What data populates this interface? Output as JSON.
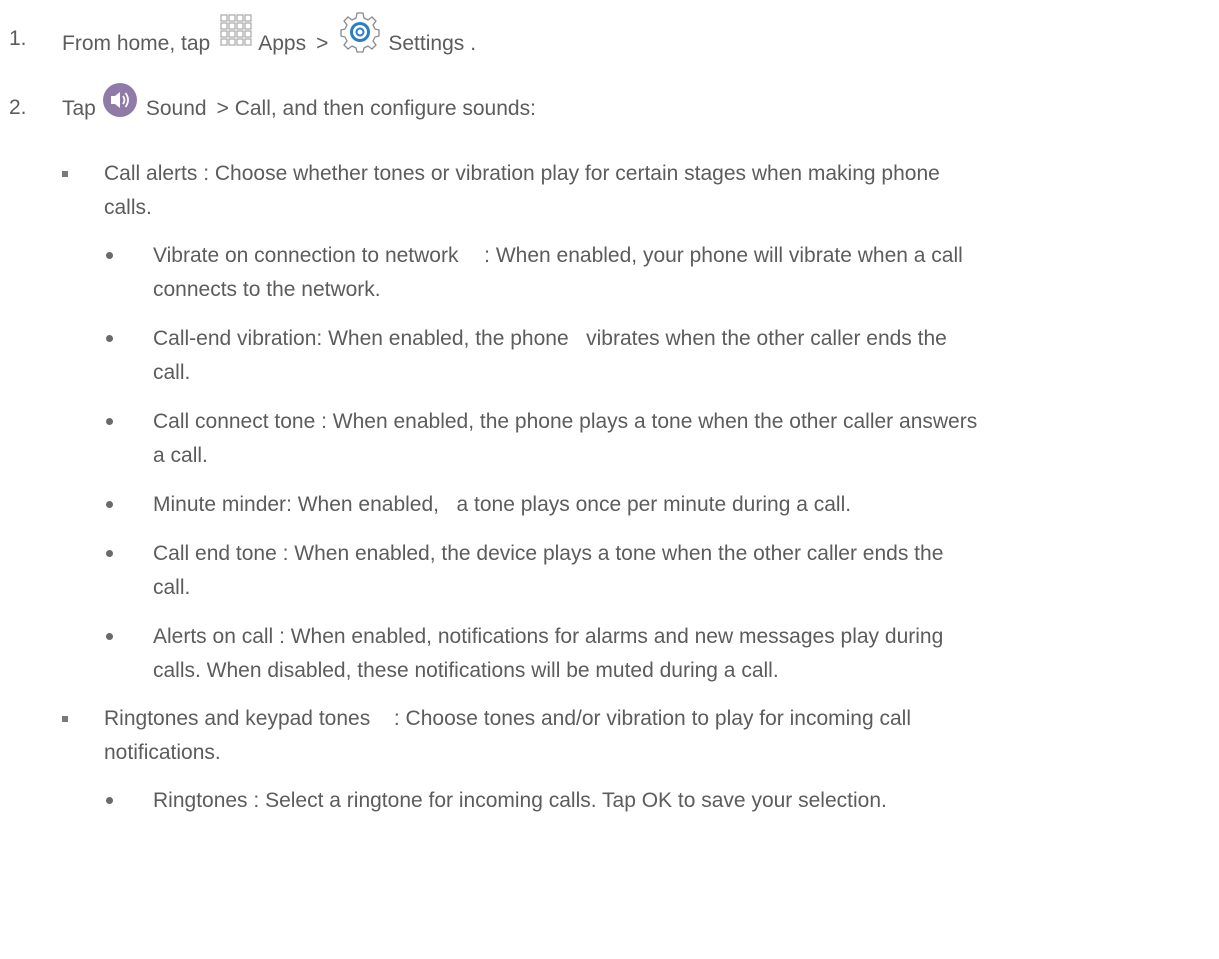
{
  "steps": [
    {
      "number": "1.",
      "prefix": "From home, tap",
      "icon1": "apps-grid-icon",
      "label1": "Apps",
      "sep": ">",
      "icon2": "settings-gear-icon",
      "label2": "Settings",
      "suffix": "."
    },
    {
      "number": "2.",
      "prefix": "Tap",
      "icon1": "sound-speaker-icon",
      "label1": "Sound",
      "sep": "> Call",
      "suffix": ", and then configure sounds:"
    }
  ],
  "items": [
    {
      "term": "Call alerts",
      "desc_line1": ": Choose whether tones or vibration play for certain stages when making phone",
      "desc_line2": "calls."
    },
    {
      "term": "Vibrate on connection to network",
      "desc_line1": ": When enabled, your phone will vibrate when a call",
      "desc_line2": "connects to the network."
    },
    {
      "term": "Call-end vibration",
      "desc_line1": ": When enabled, the phone   vibrates when the other caller ends the",
      "desc_line2": "call."
    },
    {
      "term": "Call connect tone",
      "desc_line1": ": When enabled, the phone plays a tone when the other caller answers",
      "desc_line2": "a call."
    },
    {
      "term": "Minute minder",
      "desc_line1": ": When enabled,   a tone plays once per minute during a call.",
      "desc_line2": ""
    },
    {
      "term": "Call end tone",
      "desc_line1": ": When enabled, the device plays a tone when the other caller ends the",
      "desc_line2": "call."
    },
    {
      "term": "Alerts on call",
      "desc_line1": ": When enabled, notifications for alarms and new messages play during",
      "desc_line2": "calls. When disabled, these notifications will be muted during a call."
    },
    {
      "term": "Ringtones and keypad tones",
      "desc_line1": ": Choose tones and/or vibration to play for incoming call",
      "desc_line2": "notifications."
    },
    {
      "term": "Ringtones",
      "desc_line1": ": Select a ringtone for incoming calls. Tap OK to save your selection.",
      "desc_line2": ""
    }
  ]
}
